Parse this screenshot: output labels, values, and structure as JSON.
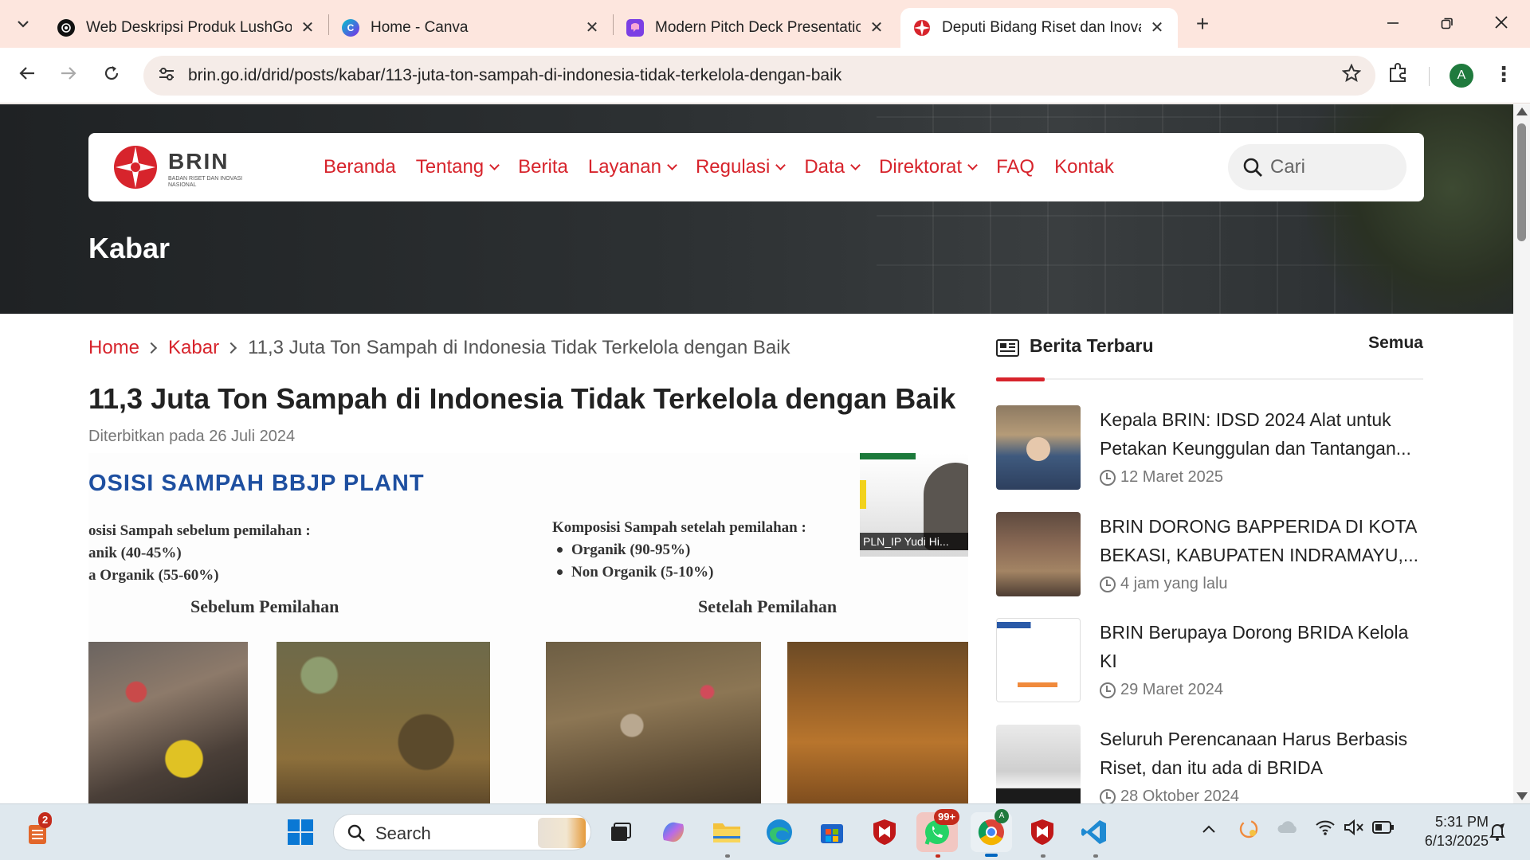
{
  "browser": {
    "tabs": [
      {
        "title": "Web Deskripsi Produk LushGo",
        "icon": "openai-icon",
        "active": false
      },
      {
        "title": "Home - Canva",
        "icon": "canva-icon",
        "active": false
      },
      {
        "title": "Modern Pitch Deck Presentation",
        "icon": "pitch-icon",
        "active": false
      },
      {
        "title": "Deputi Bidang Riset dan Inovasi",
        "icon": "brin-icon",
        "active": true
      }
    ],
    "url": "brin.go.id/drid/posts/kabar/113-juta-ton-sampah-di-indonesia-tidak-terkelola-dengan-baik",
    "profile_initial": "A"
  },
  "site": {
    "logo_text": "BRIN",
    "logo_sub": "BADAN RISET DAN INOVASI NASIONAL",
    "accent": "#d7242c",
    "nav": [
      {
        "label": "Beranda",
        "dropdown": false
      },
      {
        "label": "Tentang",
        "dropdown": true
      },
      {
        "label": "Berita",
        "dropdown": false
      },
      {
        "label": "Layanan",
        "dropdown": true
      },
      {
        "label": "Regulasi",
        "dropdown": true
      },
      {
        "label": "Data",
        "dropdown": true
      },
      {
        "label": "Direktorat",
        "dropdown": true
      },
      {
        "label": "FAQ",
        "dropdown": false
      },
      {
        "label": "Kontak",
        "dropdown": false
      }
    ],
    "search_placeholder": "Cari",
    "hero_title": "Kabar"
  },
  "breadcrumb": {
    "home": "Home",
    "section": "Kabar",
    "current": "11,3 Juta Ton Sampah di Indonesia Tidak Terkelola dengan Baik"
  },
  "article": {
    "title": "11,3 Juta Ton Sampah di Indonesia Tidak Terkelola dengan Baik",
    "published": "Diterbitkan pada 26 Juli 2024",
    "figure": {
      "heading": "OSISI SAMPAH BBJP PLANT",
      "left_lines": [
        "osisi Sampah sebelum pemilahan :",
        "anik (40-45%)",
        "a Organik (55-60%)"
      ],
      "right_title": "Komposisi Sampah setelah pemilahan :",
      "right_items": [
        "Organik (90-95%)",
        "Non Organik (5-10%)"
      ],
      "caption_before": "Sebelum Pemilahan",
      "caption_after": "Setelah Pemilahan",
      "video_label": "PLN_IP Yudi Hi..."
    }
  },
  "sidebar": {
    "title": "Berita Terbaru",
    "all_label": "Semua",
    "items": [
      {
        "headline": "Kepala BRIN: IDSD 2024 Alat untuk Petakan Keunggulan dan Tantangan...",
        "date": "12 Maret 2025"
      },
      {
        "headline": "BRIN DORONG BAPPERIDA DI KOTA BEKASI, KABUPATEN INDRAMAYU,...",
        "date": "4 jam yang lalu"
      },
      {
        "headline": "BRIN Berupaya Dorong BRIDA Kelola KI",
        "date": "29 Maret 2024"
      },
      {
        "headline": "Seluruh Perencanaan Harus Berbasis Riset, dan itu ada di BRIDA",
        "date": "28 Oktober 2024"
      }
    ]
  },
  "taskbar": {
    "search_label": "Search",
    "widget_badge": "2",
    "whatsapp_badge": "99+",
    "time": "5:31 PM",
    "date": "6/13/2025"
  }
}
